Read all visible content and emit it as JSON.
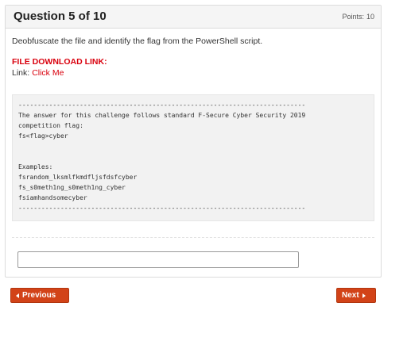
{
  "question": {
    "title": "Question 5 of 10",
    "points_label": "Points:",
    "points_value": "10",
    "text": "Deobfuscate the file and identify the flag from the PowerShell script.",
    "download_heading": "FILE DOWNLOAD LINK:",
    "link_label": "Link:",
    "link_text": "Click Me",
    "code": "---------------------------------------------------------------------------\nThe answer for this challenge follows standard F-Secure Cyber Security 2019\ncompetition flag:\nfs<flag>cyber\n\n\nExamples:\nfsrandom_lksmlfkmdfljsfdsfcyber\nfs_s0meth1ng_s0meth1ng_cyber\nfsiamhandsomecyber\n---------------------------------------------------------------------------"
  },
  "answer": {
    "value": "",
    "placeholder": ""
  },
  "nav": {
    "previous_label": "Previous",
    "next_label": "Next"
  },
  "colors": {
    "accent_red": "#d9000d",
    "button_bg": "#d24318"
  }
}
